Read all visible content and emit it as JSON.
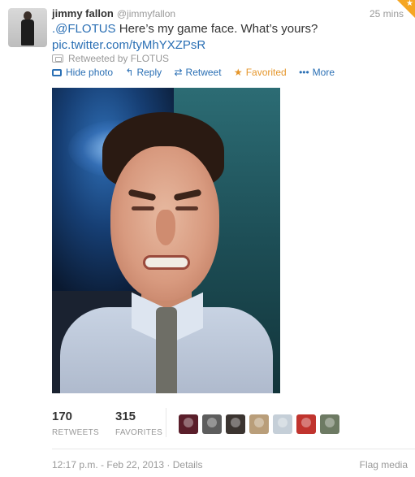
{
  "tweet": {
    "fullname": "jimmy fallon",
    "username": "@jimmyfallon",
    "time": "25 mins",
    "text_mention": ".@FLOTUS",
    "text_body": " Here’s my game face. What’s yours?",
    "text_link": "pic.twitter.com/tyMhYXZPsR",
    "retweeted_by": "Retweeted by FLOTUS"
  },
  "actions": {
    "hide_photo": "Hide photo",
    "reply": "Reply",
    "retweet": "Retweet",
    "favorited": "Favorited",
    "more": "More"
  },
  "icons": {
    "reply": "↰",
    "retweet": "⇄",
    "favorited": "★",
    "more": "•••",
    "corner": "★"
  },
  "stats": {
    "retweets_count": "170",
    "retweets_label": "RETWEETS",
    "favorites_count": "315",
    "favorites_label": "FAVORITES"
  },
  "favoriters": [
    {
      "name": "avatar-1",
      "color": "#5a1e2a"
    },
    {
      "name": "avatar-2",
      "color": "#5d5d5d"
    },
    {
      "name": "avatar-3",
      "color": "#3b3430"
    },
    {
      "name": "avatar-4",
      "color": "#b99e7a"
    },
    {
      "name": "avatar-5",
      "color": "#c5cfd8"
    },
    {
      "name": "avatar-6",
      "color": "#c0342e"
    },
    {
      "name": "avatar-7",
      "color": "#6d7a63"
    }
  ],
  "footer": {
    "timestamp": "12:17 p.m. - Feb 22, 2013",
    "separator": " · ",
    "details": "Details",
    "flag_media": "Flag media"
  },
  "colors": {
    "link": "#2a6fb4",
    "favorited": "#e5962b",
    "muted": "#999999",
    "text": "#333333"
  }
}
